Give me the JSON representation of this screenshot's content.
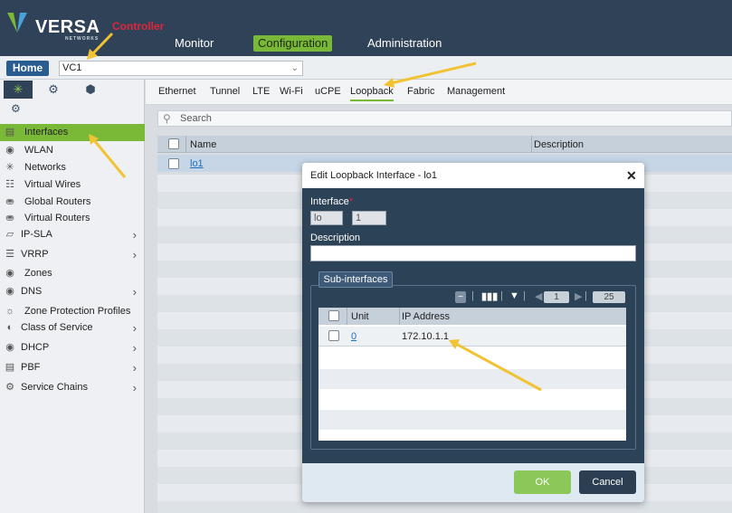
{
  "brand": {
    "name": "VERSA",
    "sub": "NETWORKS",
    "color": "#2f4257",
    "accent": "#7ab838"
  },
  "annotation": {
    "controller_label": "Controller"
  },
  "top_nav": [
    {
      "label": "Monitor",
      "active": false
    },
    {
      "label": "Configuration",
      "active": true
    },
    {
      "label": "Administration",
      "active": false
    }
  ],
  "breadcrumb": {
    "home_label": "Home",
    "org_value": "VC1"
  },
  "sidebar": {
    "tab_icons": [
      "network-icon",
      "gear-icon",
      "box-icon"
    ],
    "sub_icon": "globe-gear-icon",
    "items": [
      {
        "label": "Interfaces",
        "icon": "interface-icon",
        "selected": true,
        "expandable": false
      },
      {
        "label": "WLAN",
        "icon": "wifi-icon",
        "selected": false,
        "expandable": false
      },
      {
        "label": "Networks",
        "icon": "networks-icon",
        "selected": false,
        "expandable": false
      },
      {
        "label": "Virtual Wires",
        "icon": "wires-icon",
        "selected": false,
        "expandable": false
      },
      {
        "label": "Global Routers",
        "icon": "router-icon",
        "selected": false,
        "expandable": false
      },
      {
        "label": "Virtual Routers",
        "icon": "router-icon",
        "selected": false,
        "expandable": false
      },
      {
        "label": "IP-SLA",
        "icon": "pulse-icon",
        "selected": false,
        "expandable": true
      },
      {
        "label": "VRRP",
        "icon": "vrrp-icon",
        "selected": false,
        "expandable": true
      },
      {
        "label": "Zones",
        "icon": "zones-icon",
        "selected": false,
        "expandable": false
      },
      {
        "label": "DNS",
        "icon": "dns-icon",
        "selected": false,
        "expandable": true
      },
      {
        "label": "Zone Protection Profiles",
        "icon": "shield-icon",
        "selected": false,
        "expandable": false
      },
      {
        "label": "Class of Service",
        "icon": "cos-icon",
        "selected": false,
        "expandable": true
      },
      {
        "label": "DHCP",
        "icon": "dhcp-icon",
        "selected": false,
        "expandable": true
      },
      {
        "label": "PBF",
        "icon": "pbf-icon",
        "selected": false,
        "expandable": true
      },
      {
        "label": "Service Chains",
        "icon": "gear-icon",
        "selected": false,
        "expandable": true
      }
    ]
  },
  "interface_tabs": [
    "Ethernet",
    "Tunnel",
    "LTE",
    "Wi-Fi",
    "uCPE",
    "Loopback",
    "Fabric",
    "Management"
  ],
  "selected_tab": "Loopback",
  "search": {
    "placeholder": "Search"
  },
  "grid": {
    "columns": [
      "Name",
      "Description"
    ],
    "rows": [
      {
        "name": "lo1",
        "description": ""
      }
    ]
  },
  "dialog": {
    "title": "Edit Loopback Interface - lo1",
    "interface_label": "Interface",
    "interface_name": "lo",
    "interface_unit": "1",
    "description_label": "Description",
    "description_value": "",
    "subinterfaces_label": "Sub-interfaces",
    "toolbar": {
      "page": "1",
      "page_size": "25"
    },
    "sub_columns": [
      "Unit",
      "IP Address"
    ],
    "sub_rows": [
      {
        "unit": "0",
        "ip": "172.10.1.1"
      }
    ],
    "ok_label": "OK",
    "cancel_label": "Cancel"
  },
  "colors": {
    "highlight_green": "#7ab838",
    "ok_green": "#8cc859",
    "arrow": "#f1c232",
    "dialog_bg": "#2b4257"
  }
}
